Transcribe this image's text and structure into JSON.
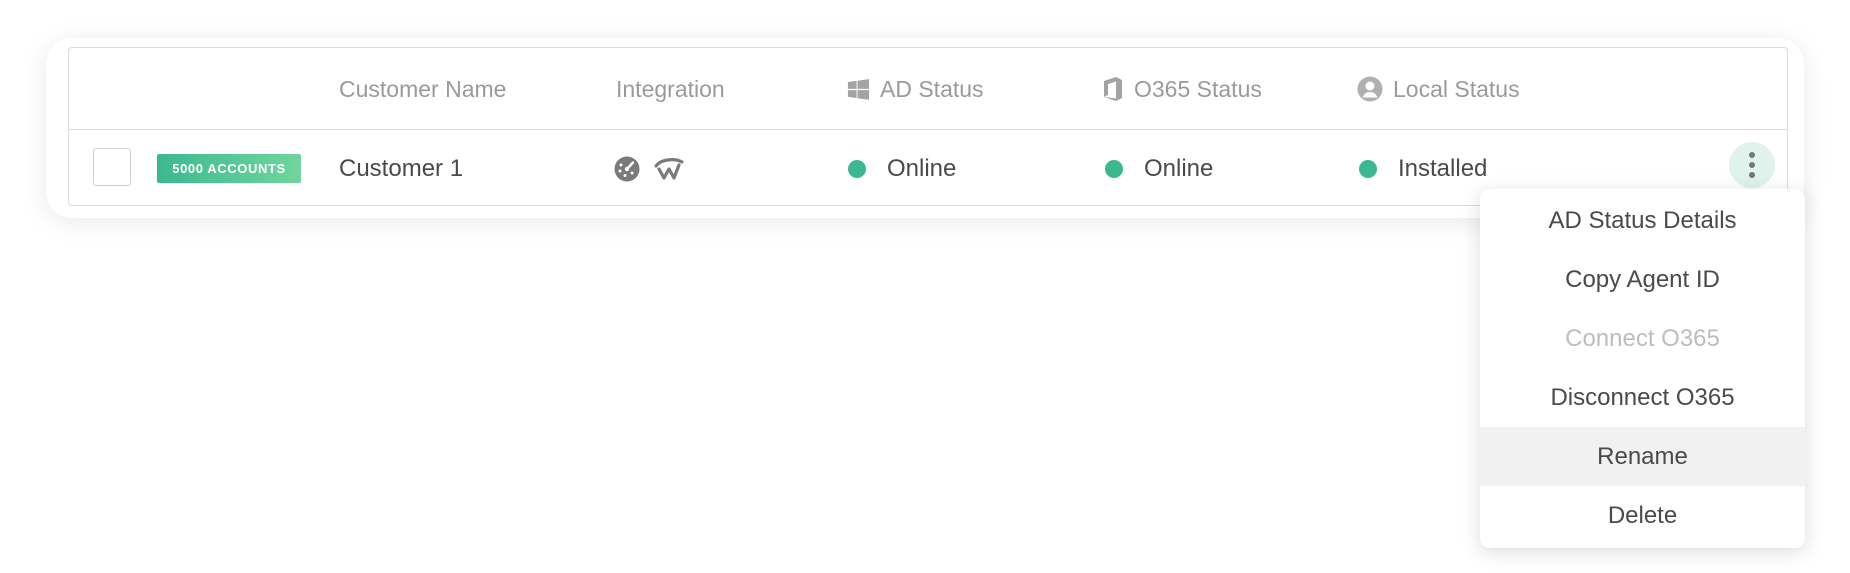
{
  "table": {
    "headers": {
      "customer_name": "Customer Name",
      "integration": "Integration",
      "ad_status": "AD Status",
      "o365_status": "O365 Status",
      "local_status": "Local Status"
    },
    "header_icons": {
      "ad_status": "windows-icon",
      "o365_status": "office-icon",
      "local_status": "user-circle-icon"
    },
    "row": {
      "badge": "5000 ACCOUNTS",
      "customer_name": "Customer 1",
      "integration_icons": [
        "gauge-icon",
        "connectwise-icon"
      ],
      "ad_status": "Online",
      "o365_status": "Online",
      "local_status": "Installed"
    }
  },
  "menu": {
    "items": [
      {
        "label": "AD Status Details",
        "state": "enabled"
      },
      {
        "label": "Copy Agent ID",
        "state": "enabled"
      },
      {
        "label": "Connect O365",
        "state": "disabled"
      },
      {
        "label": "Disconnect O365",
        "state": "enabled"
      },
      {
        "label": "Rename",
        "state": "hovered"
      },
      {
        "label": "Delete",
        "state": "enabled"
      }
    ]
  },
  "colors": {
    "status_green": "#3cb891",
    "badge_gradient_start": "#3cb891",
    "badge_gradient_end": "#6fd69d",
    "kebab_bg": "#dff3ec",
    "header_text": "#9a9a9a",
    "disabled_text": "#bdbdbd"
  }
}
